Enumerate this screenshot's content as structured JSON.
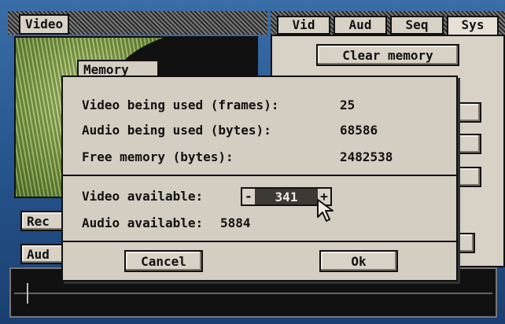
{
  "window": {
    "title": "Video"
  },
  "tabs": [
    {
      "label": "Vid"
    },
    {
      "label": "Aud"
    },
    {
      "label": "Seq"
    },
    {
      "label": "Sys"
    }
  ],
  "sys_panel": {
    "clear_memory_label": "Clear memory"
  },
  "background_buttons": {
    "rec_label": "Rec",
    "aud_label": "Aud"
  },
  "dialog": {
    "title": "Memory",
    "video_used_label": "Video being used (frames):",
    "video_used_value": "25",
    "audio_used_label": "Audio being used (bytes):",
    "audio_used_value": "68586",
    "free_memory_label": "Free memory (bytes):",
    "free_memory_value": "2482538",
    "video_available_label": "Video available:",
    "video_available_value": "341",
    "stepper_minus": "-",
    "stepper_plus": "+",
    "audio_available_label": "Audio available:",
    "audio_available_value": "5884",
    "cancel_label": "Cancel",
    "ok_label": "Ok"
  },
  "colors": {
    "dialog_bg": "#d4cdc1",
    "stepper_bg": "#3d3a35",
    "desktop": "#26558e"
  }
}
